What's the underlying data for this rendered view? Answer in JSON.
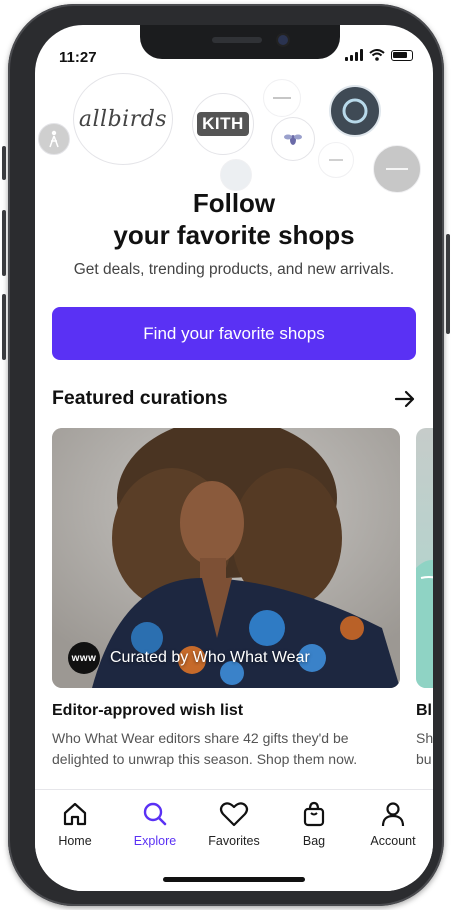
{
  "status_bar": {
    "time": "11:27"
  },
  "logos": {
    "allbirds": "allbirds",
    "kith": "KITH"
  },
  "hero": {
    "title_line1": "Follow",
    "title_line2": "your favorite shops",
    "subtitle": "Get deals, trending products, and new arrivals.",
    "cta_label": "Find your favorite shops"
  },
  "featured": {
    "section_title": "Featured curations",
    "cards": [
      {
        "curator_badge": "www",
        "curator_label": "Curated by Who What Wear",
        "title": "Editor-approved wish list",
        "description": "Who What Wear editors share 42 gifts they'd be delighted to unwrap this season. Shop them now."
      },
      {
        "title": "Bl",
        "description": "Sh\nbu"
      }
    ]
  },
  "tabs": [
    {
      "label": "Home",
      "icon": "home-icon"
    },
    {
      "label": "Explore",
      "icon": "search-icon",
      "active": true
    },
    {
      "label": "Favorites",
      "icon": "heart-icon"
    },
    {
      "label": "Bag",
      "icon": "bag-icon"
    },
    {
      "label": "Account",
      "icon": "person-icon"
    }
  ],
  "colors": {
    "accent": "#5a31f4"
  }
}
